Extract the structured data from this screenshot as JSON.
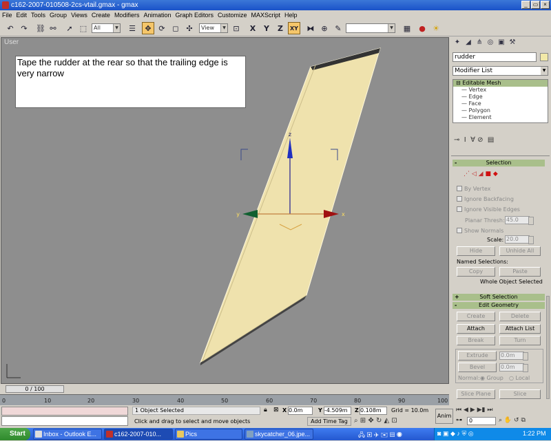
{
  "window": {
    "title": "c162-2007-010508-2cs-vtail.gmax - gmax",
    "min": "_",
    "restore": "▭",
    "close": "×"
  },
  "menu": [
    "File",
    "Edit",
    "Tools",
    "Group",
    "Views",
    "Create",
    "Modifiers",
    "Animation",
    "Graph Editors",
    "Customize",
    "MAXScript",
    "Help"
  ],
  "toolbar": {
    "selection_filter": "All",
    "ref_coord": "View"
  },
  "viewport": {
    "label": "User",
    "note": "Tape the rudder at the rear so that the trailing edge is very narrow",
    "axis_x": "x",
    "axis_y": "y",
    "axis_z": "z"
  },
  "command_panel": {
    "object_name": "rudder",
    "modifier_list": "Modifier List",
    "stack": {
      "root": "Editable Mesh",
      "items": [
        "Vertex",
        "Edge",
        "Face",
        "Polygon",
        "Element"
      ]
    },
    "selection": {
      "header": "Selection",
      "sign": "-",
      "by_vertex": "By Vertex",
      "ignore_backfacing": "Ignore Backfacing",
      "ignore_visible_edges": "Ignore Visible Edges",
      "planar_thresh_label": "Planar Thresh:",
      "planar_thresh": "45.0",
      "show_normals": "Show Normals",
      "scale_label": "Scale:",
      "scale": "20.0",
      "hide": "Hide",
      "unhide_all": "Unhide All",
      "named_selections": "Named Selections:",
      "copy": "Copy",
      "paste": "Paste",
      "whole_object": "Whole Object Selected"
    },
    "soft_selection": {
      "header": "Soft Selection",
      "sign": "+"
    },
    "edit_geometry": {
      "header": "Edit Geometry",
      "sign": "-",
      "create": "Create",
      "delete": "Delete",
      "attach": "Attach",
      "attach_list": "Attach List",
      "break": "Break",
      "turn": "Turn",
      "extrude": "Extrude",
      "extrude_val": "0.0m",
      "bevel": "Bevel",
      "bevel_val": "0.0m",
      "normal_label": "Normal:",
      "group": "Group",
      "local": "Local",
      "slice_plane": "Slice Plane",
      "slice": "Slice"
    }
  },
  "timeline": {
    "slider": "0 / 100",
    "ticks": [
      "0",
      "10",
      "20",
      "30",
      "40",
      "50",
      "60",
      "70",
      "80",
      "90",
      "100"
    ]
  },
  "status": {
    "selected": "1 Object Selected",
    "prompt": "Click and drag to select and move objects",
    "x": "0.0m",
    "y": "-4.509m",
    "z": "0.108m",
    "grid": "Grid = 10.0m",
    "add_time_tag": "Add Time Tag",
    "anim": "Anim",
    "frame": "0"
  },
  "taskbar": {
    "start": "Start",
    "tasks": [
      "Inbox - Outlook E...",
      "c162-2007-010...",
      "Pics",
      "skycatcher_06.jpe..."
    ],
    "clock": "1:22 PM"
  },
  "colors": {
    "viewport_bg": "#8e8e8e",
    "mesh_fill": "#efe2ad",
    "rollout_header": "#a9bf8b",
    "taskbar": "#2458d0"
  }
}
